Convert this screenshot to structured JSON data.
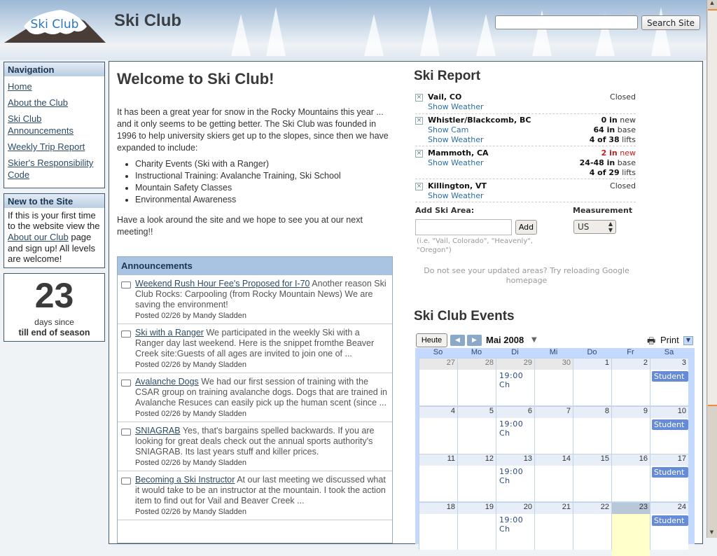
{
  "header": {
    "site_title": "Ski Club",
    "logo_text": "Ski Club",
    "search_placeholder": "",
    "search_button": "Search Site"
  },
  "sidebar": {
    "navigation": {
      "title": "Navigation",
      "items": [
        {
          "label": "Home"
        },
        {
          "label": "About the Club"
        },
        {
          "label": "Ski Club Announcements"
        },
        {
          "label": "Weekly Trip Report"
        },
        {
          "label": "Skier's Responsibility Code"
        }
      ]
    },
    "new_to_site": {
      "title": "New to the Site",
      "text_before": "If this is your first time to the website view the ",
      "link": "About our Club",
      "text_after": " page and sign up! All levels are welcome!"
    },
    "counter": {
      "number": "23",
      "line1": "days since",
      "line2": "till end of season"
    }
  },
  "welcome": {
    "title": "Welcome to Ski Club!",
    "intro": "It has been a great year for snow in the Rocky Mountains this year ... and it only seems to be getting better. The Ski Club was founded in 1996 to help university skiers get up to the slopes, since then we have expanded to include:",
    "list": [
      "Charity Events (Ski with a Ranger)",
      "Instructional Training: Avalanche Training, Ski School",
      "Mountain Safety Classes",
      "Environmental Awareness"
    ],
    "outro": "Have a look around the site and we hope to see you at our next meeting!!"
  },
  "announcements": {
    "title": "Announcements",
    "items": [
      {
        "title": "Weekend Rush Hour Fee's Proposed for I-70",
        "text": " Another reason Ski Club Rocks: Carpooling (from Rocky Mountain News) We are saving the environment!",
        "meta": "Posted 02/26 by Mandy Sladden"
      },
      {
        "title": "Ski with a Ranger",
        "text": " We participated in the weekly Ski with a Ranger day last weekend. Here is the snippet fromthe Beaver Creek site:Guests of all ages are invited to join one of ...",
        "meta": "Posted 02/26 by Mandy Sladden"
      },
      {
        "title": "Avalanche Dogs",
        "text": " We had our first session of training with the CSAR group on training avalanche dogs. Dogs that are trained in Avalanche Resuces can easily pick up the human scent (since ...",
        "meta": "Posted 02/26 by Mandy Sladden"
      },
      {
        "title": "SNIAGRAB",
        "text": " Yes, that's bargains spelled backwards. If you are looking for great deals check out the annual sports authority's SNIAGRAB. Its last years stuff and killer prices.",
        "meta": "Posted 02/26 by Mandy Sladden"
      },
      {
        "title": "Becoming a Ski Instructor",
        "text": " At our last meeting we discussed what it would take to be an instructor at the mountain. I took the action item to find out for Vail and Beaver Creek ...",
        "meta": "Posted 02/26 by Mandy Sladden"
      }
    ]
  },
  "ski_report": {
    "title": "Ski Report",
    "areas": [
      {
        "name": "Vail, CO",
        "links": [
          "Show Weather"
        ],
        "status": "Closed"
      },
      {
        "name": "Whistler/Blackcomb, BC",
        "links": [
          "Show Cam",
          "Show Weather"
        ],
        "stats": [
          [
            "0 in",
            "new"
          ],
          [
            "64 in",
            "base"
          ],
          [
            "4 of 38",
            "lifts"
          ]
        ]
      },
      {
        "name": "Mammoth, CA",
        "links": [
          "Show Weather"
        ],
        "stats": [
          [
            "2 in",
            "new"
          ],
          [
            "24-48 in",
            "base"
          ],
          [
            "4 of 29",
            "lifts"
          ]
        ]
      },
      {
        "name": "Killington, VT",
        "links": [
          "Show Weather"
        ],
        "status": "Closed"
      }
    ],
    "add_label": "Add Ski Area:",
    "add_button": "Add",
    "hint": "(i.e. \"Vail, Colorado\", \"Heavenly\", \"Oregon\")",
    "measurement_label": "Measurement",
    "measurement_value": "US",
    "reload_note": "Do not see your updated areas? Try reloading Google homepage"
  },
  "events": {
    "title": "Ski Club Events",
    "today_button": "Heute",
    "month": "Mai 2008",
    "print": "Print",
    "days": [
      "So",
      "Mo",
      "Di",
      "Mi",
      "Do",
      "Fr",
      "Sa"
    ],
    "weeks": [
      [
        "27",
        "28",
        "29",
        "30",
        "1",
        "2",
        "3"
      ],
      [
        "4",
        "5",
        "6",
        "7",
        "8",
        "9",
        "10"
      ],
      [
        "11",
        "12",
        "13",
        "14",
        "15",
        "16",
        "17"
      ],
      [
        "18",
        "19",
        "20",
        "21",
        "22",
        "23",
        "24"
      ]
    ],
    "tuesday_event": "19:00 Ch",
    "saturday_event": "Student",
    "today": "23"
  }
}
